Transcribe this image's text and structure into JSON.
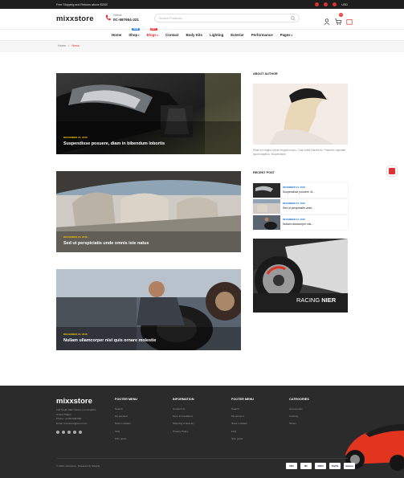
{
  "topbar": {
    "promo": "Free Shipping and Returns above $200!",
    "lang": "USD"
  },
  "header": {
    "logo": "mixxstore",
    "phone_label": "Hotline:",
    "phone": "0C-987654-321",
    "search_placeholder": "Search Products...",
    "cart_count": "0"
  },
  "nav": {
    "items": [
      {
        "label": "Home",
        "badge": "",
        "badge_color": ""
      },
      {
        "label": "Shop",
        "badge": "NEW",
        "badge_color": "#2a7fd0",
        "caret": true
      },
      {
        "label": "Blogs",
        "badge": "HOT",
        "badge_color": "#e33",
        "caret": true,
        "active": true
      },
      {
        "label": "Contact",
        "badge": ""
      },
      {
        "label": "Body Kits",
        "badge": ""
      },
      {
        "label": "Lighting",
        "badge": ""
      },
      {
        "label": "Exterior",
        "badge": ""
      },
      {
        "label": "Performance",
        "badge": ""
      },
      {
        "label": "Pages",
        "badge": "",
        "caret": true
      }
    ]
  },
  "breadcrumb": {
    "home": "Home",
    "sep": "/",
    "current": "News"
  },
  "posts": [
    {
      "date": "DECEMBER 24, 2018",
      "title": "Suspendisse posuere, diam in bibendum lobortis"
    },
    {
      "date": "DECEMBER 24, 2018",
      "title": "Sed ut perspiciatis unde omnis iste natus"
    },
    {
      "date": "DECEMBER 24, 2018",
      "title": "Nullam ullamcorper nisl quis ornare molestie"
    }
  ],
  "sidebar": {
    "about_title": "ABOUT AUTHOR",
    "about_text": "Etiam ex magna rutrum feugiat cursus. Cras mollis blandit dui. Praesent vulputate ipsum dapibus. Suspendisse",
    "recent_title": "RECENT POST",
    "recent": [
      {
        "date": "DECEMBER 24, 2018",
        "title": "Suspendisse posuere, di..."
      },
      {
        "date": "DECEMBER 24, 2018",
        "title": "Sed ut perspiciatis unde..."
      },
      {
        "date": "DECEMBER 24, 2018",
        "title": "Nullam ullamcorper nisl..."
      }
    ],
    "promo_a": "RACING ",
    "promo_b": "NIER"
  },
  "footer": {
    "logo": "mixxstore",
    "address": [
      "123 South Main Street, Los Angeles",
      "United States",
      "Phone: +0190 608 880",
      "Email: mixxstore@com.com"
    ],
    "cols": [
      {
        "h": "FOOTER MENU",
        "links": [
          "Search",
          "My account",
          "Store Location",
          "FAQ",
          "Size guide"
        ]
      },
      {
        "h": "INFORMATION",
        "links": [
          "Contact Us",
          "Term & Conditions",
          "Shipping & Delivery",
          "Privacy Policy"
        ]
      },
      {
        "h": "FOOTER MENU",
        "links": [
          "Search",
          "My account",
          "Store Location",
          "FAQ",
          "Size guide"
        ]
      },
      {
        "h": "CATEGORIES",
        "links": [
          "Accessories",
          "Clothing",
          "Shoes"
        ]
      }
    ],
    "copyright": "© 2021, mixxstore. Powered by Shopify",
    "payments": [
      "VISA",
      "MC",
      "AMEX",
      "PayPal",
      "amazon"
    ]
  },
  "colors": {
    "accent": "#dd3333",
    "date": "#f2c200",
    "footer_bg": "#2b2b2b"
  }
}
